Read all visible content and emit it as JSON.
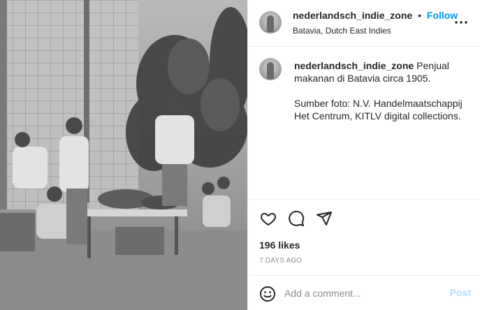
{
  "post": {
    "photo_icon": "vintage-photo",
    "username": "nederlandsch_indie_zone",
    "separator": "•",
    "follow_label": "Follow",
    "location": "Batavia, Dutch East Indies",
    "more_icon": "more-horizontal-icon"
  },
  "caption": {
    "username": "nederlandsch_indie_zone",
    "line1": "Penjual makanan di Batavia circa 1905.",
    "line2": "Sumber foto: N.V. Handelmaatschappij Het Centrum, KITLV digital collections."
  },
  "actions": {
    "icons": [
      "heart-icon",
      "comment-icon",
      "share-icon"
    ],
    "likes": "196 likes",
    "time": "7 DAYS AGO"
  },
  "comment": {
    "placeholder": "Add a comment...",
    "post_label": "Post",
    "emoji_icon": "emoji-icon"
  },
  "colors": {
    "link": "#0095f6",
    "post_disabled": "#b2dffc",
    "muted": "#8e8e8e",
    "text": "#262626"
  }
}
